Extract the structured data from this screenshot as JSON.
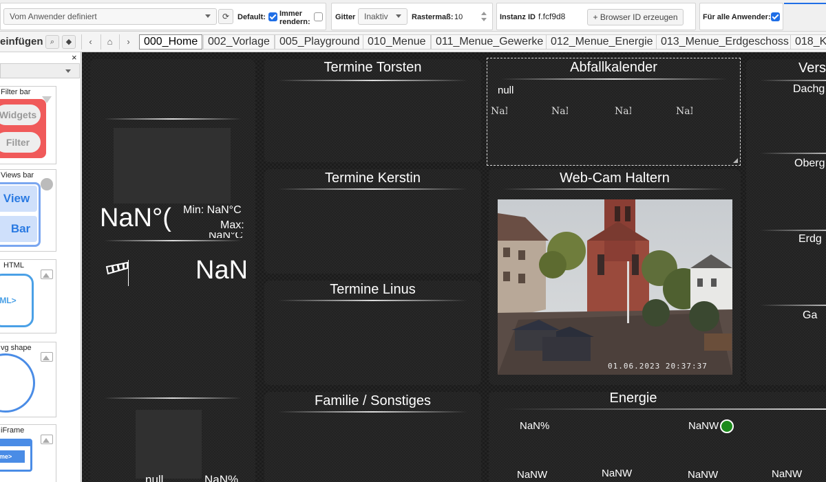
{
  "toolbar": {
    "view_select": "Vom Anwender definiert",
    "default_label": "Default:",
    "always_render_label": "Immer rendern:",
    "grid_label": "Gitter",
    "grid_value": "Inaktiv",
    "grid_size_label": "Rastermaß:",
    "grid_size_value": "10",
    "instance_label": "Instanz ID",
    "instance_value": "f.fcf9d8",
    "browser_id_button": "Browser ID erzeugen",
    "all_users_label": "Für alle Anwender:"
  },
  "row2": {
    "insert_title": "einfügen",
    "tabs": [
      "000_Home",
      "002_Vorlage",
      "005_Playground",
      "010_Menue",
      "011_Menue_Gewerke",
      "012_Menue_Energie",
      "013_Menue_Erdgeschoss",
      "018_K"
    ]
  },
  "palette": {
    "close": "×",
    "cards": [
      {
        "label": "Filter bar",
        "items": [
          "Widgets",
          "Filter"
        ]
      },
      {
        "label": "Views bar",
        "items": [
          "View",
          "Bar"
        ]
      },
      {
        "label": "HTML",
        "items": [
          "TML>"
        ]
      },
      {
        "label": "vg shape",
        "items": []
      },
      {
        "label": "iFrame",
        "items": [
          "ame>"
        ]
      }
    ]
  },
  "weather": {
    "temp": "NaN°(",
    "min": "Min: NaN°C",
    "max": "Max:",
    "max_value": "NaN°C",
    "wind": "NaN",
    "bottom_left": "null",
    "bottom_right": "NaN%"
  },
  "panels": {
    "torsten": "Termine Torsten",
    "kerstin": "Termine Kerstin",
    "linus": "Termine Linus",
    "familie": "Familie / Sonstiges",
    "abfall": "Abfallkalender",
    "webcam": "Web-Cam Haltern",
    "energie": "Energie",
    "right_title": "Vers"
  },
  "abfall": {
    "value": "null",
    "items": [
      "NaN",
      "NaN",
      "NaN",
      "NaN"
    ]
  },
  "webcam": {
    "timestamp": "01.06.2023 20:37:37"
  },
  "energie": {
    "percent": "NaN%",
    "power": "NaNW",
    "row": [
      "NaNW",
      "NaNW",
      "NaNW",
      "NaNW"
    ]
  },
  "right_column": [
    "Dachg",
    "Oberg",
    "Erdg",
    "Ga"
  ],
  "colors": {
    "accent": "#1f6ee6",
    "status_dot": "#1c8a1c",
    "canvas_bg": "#242424"
  }
}
